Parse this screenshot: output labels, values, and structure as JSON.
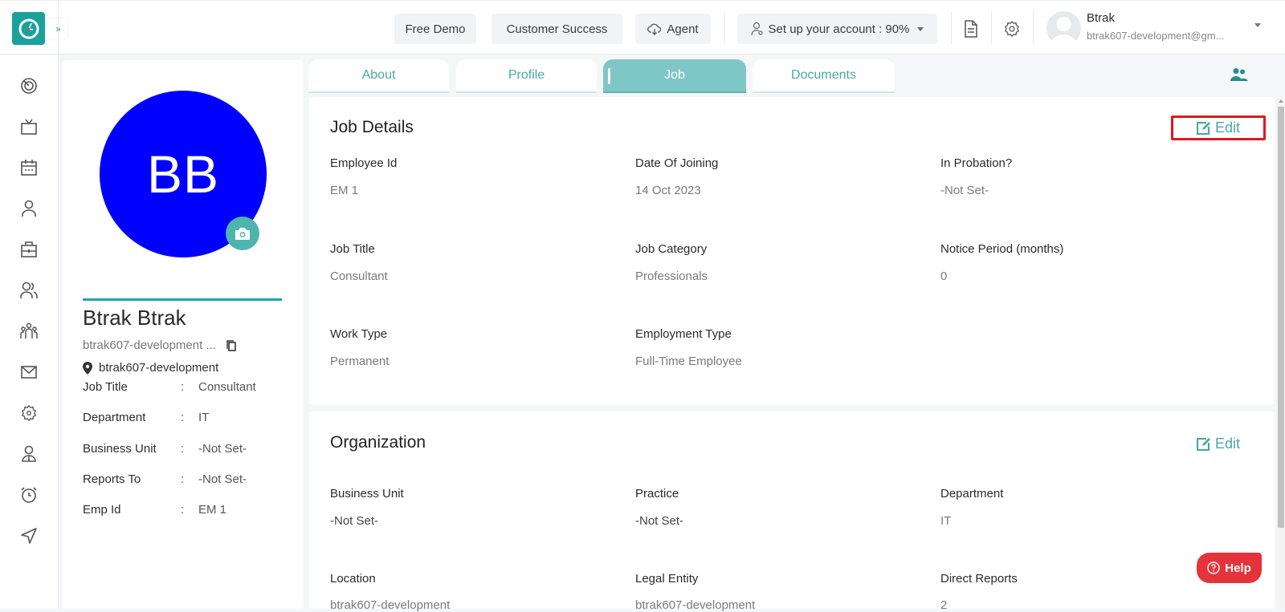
{
  "header": {
    "logo_icon": "clock-icon",
    "expand_icon": "chevrons-right-icon",
    "buttons": {
      "free_demo": "Free Demo",
      "customer_success": "Customer Success",
      "agent": "Agent",
      "setup_account": "Set up your account : 90%"
    },
    "setup_progress_percent": 90,
    "user": {
      "name": "Btrak",
      "email": "btrak607-development@gm..."
    }
  },
  "leftnav": {
    "items": [
      {
        "icon": "dashboard-icon"
      },
      {
        "icon": "tv-icon"
      },
      {
        "icon": "calendar-icon"
      },
      {
        "icon": "user-icon"
      },
      {
        "icon": "briefcase-icon"
      },
      {
        "icon": "users-icon"
      },
      {
        "icon": "team-icon"
      },
      {
        "icon": "mail-icon"
      },
      {
        "icon": "settings-icon"
      },
      {
        "icon": "employee-icon"
      },
      {
        "icon": "alarm-icon"
      },
      {
        "icon": "send-icon"
      }
    ]
  },
  "profile": {
    "initials": "BB",
    "avatar_color": "#0000ff",
    "name": "Btrak Btrak",
    "email_truncated": "btrak607-development ...",
    "location": "btrak607-development",
    "details": [
      {
        "label": "Job Title",
        "value": "Consultant"
      },
      {
        "label": "Department",
        "value": "IT"
      },
      {
        "label": "Business Unit",
        "value": "-Not Set-"
      },
      {
        "label": "Reports To",
        "value": "-Not Set-"
      },
      {
        "label": "Emp Id",
        "value": "EM 1"
      }
    ],
    "colon": ":"
  },
  "tabs": [
    {
      "label": "About",
      "active": false
    },
    {
      "label": "Profile",
      "active": false
    },
    {
      "label": "Job",
      "active": true
    },
    {
      "label": "Documents",
      "active": false
    }
  ],
  "job_details": {
    "title": "Job Details",
    "edit_label": "Edit",
    "fields": [
      {
        "label": "Employee Id",
        "value": "EM 1"
      },
      {
        "label": "Date Of Joining",
        "value": "14 Oct 2023"
      },
      {
        "label": "In Probation?",
        "value": "-Not Set-"
      },
      {
        "label": "Job Title",
        "value": "Consultant"
      },
      {
        "label": "Job Category",
        "value": "Professionals"
      },
      {
        "label": "Notice Period (months)",
        "value": "0"
      },
      {
        "label": "Work Type",
        "value": "Permanent"
      },
      {
        "label": "Employment Type",
        "value": "Full-Time Employee"
      }
    ]
  },
  "organization": {
    "title": "Organization",
    "edit_label": "Edit",
    "fields": [
      {
        "label": "Business Unit",
        "value": "-Not Set-"
      },
      {
        "label": "Practice",
        "value": "-Not Set-"
      },
      {
        "label": "Department",
        "value": "IT"
      },
      {
        "label": "Location",
        "value": "btrak607-development"
      },
      {
        "label": "Legal Entity",
        "value": "btrak607-development"
      },
      {
        "label": "Direct Reports",
        "value": "2"
      }
    ]
  },
  "help": {
    "label": "Help"
  },
  "colors": {
    "brand_teal": "#1aa19b",
    "accent_teal": "#4aa9a6",
    "active_tab": "#7fc7c6",
    "highlight_red": "#e4161c",
    "help_red": "#e4333a"
  }
}
